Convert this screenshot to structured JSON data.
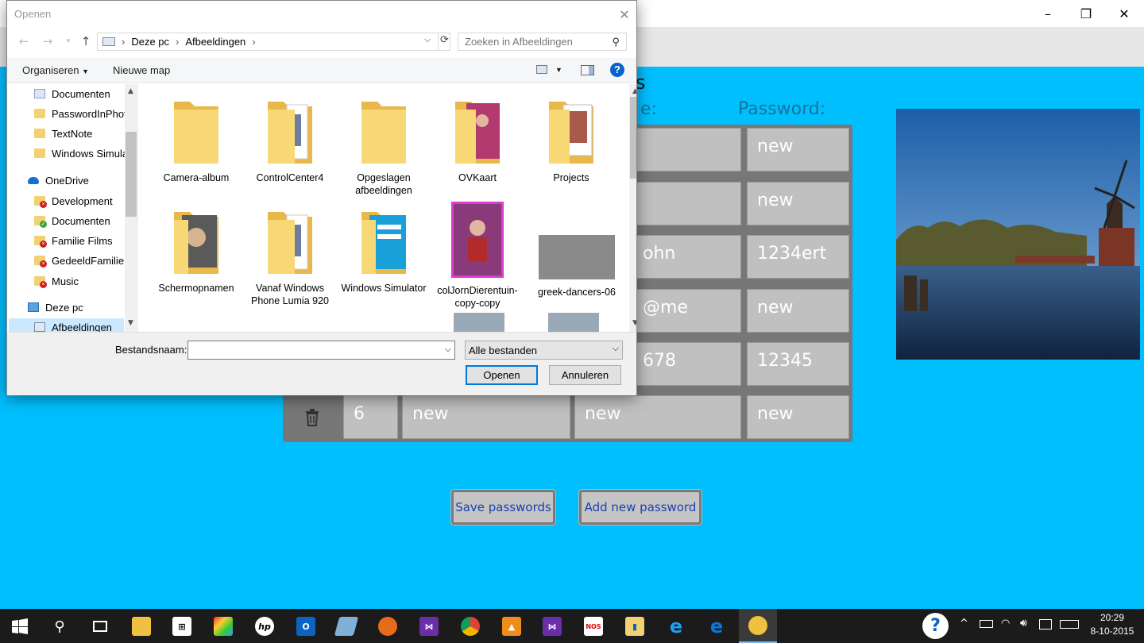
{
  "window": {
    "minimize": "–",
    "maximize": "❐",
    "close": "✕"
  },
  "main": {
    "partial_heading": "s",
    "columns": {
      "username_partial": "e:",
      "password": "Password:"
    },
    "rows": [
      {
        "username": "",
        "password": "new"
      },
      {
        "username": "",
        "password": "new"
      },
      {
        "username": "ohn",
        "password": "1234ert"
      },
      {
        "username": "@me",
        "password": "new"
      },
      {
        "username": "678",
        "password": "12345"
      },
      {
        "id": "6",
        "site": "new",
        "username": "new",
        "password": "new"
      }
    ],
    "save_label": "Save passwords",
    "add_label": "Add new password"
  },
  "dialog": {
    "title": "Openen",
    "address": {
      "root": "Deze pc",
      "folder": "Afbeeldingen"
    },
    "search_placeholder": "Zoeken in Afbeeldingen",
    "toolbar": {
      "organize": "Organiseren",
      "new_folder": "Nieuwe map"
    },
    "nav": [
      {
        "label": "Documenten",
        "type": "folder"
      },
      {
        "label": "PasswordInPhot",
        "type": "folder"
      },
      {
        "label": "TextNote",
        "type": "folder"
      },
      {
        "label": "Windows Simula",
        "type": "folder"
      },
      {
        "label": "OneDrive",
        "type": "cloud"
      },
      {
        "label": "Development",
        "type": "folder-error"
      },
      {
        "label": "Documenten",
        "type": "folder-ok"
      },
      {
        "label": "Familie Films",
        "type": "folder-error"
      },
      {
        "label": "GedeeldFamilie",
        "type": "folder-error"
      },
      {
        "label": "Music",
        "type": "folder-error"
      },
      {
        "label": "Deze pc",
        "type": "pc"
      },
      {
        "label": "Afbeeldingen",
        "type": "pictures"
      }
    ],
    "files": [
      {
        "label": "Camera-album",
        "kind": "folder"
      },
      {
        "label": "ControlCenter4",
        "kind": "folder-docs"
      },
      {
        "label": "Opgeslagen afbeeldingen",
        "kind": "folder"
      },
      {
        "label": "OVKaart",
        "kind": "folder-photo"
      },
      {
        "label": "Projects",
        "kind": "folder-photo"
      },
      {
        "label": "Schermopnamen",
        "kind": "folder-photo"
      },
      {
        "label": "Vanaf Windows Phone Lumia 920",
        "kind": "folder-docs"
      },
      {
        "label": "Windows Simulator",
        "kind": "folder-blue"
      },
      {
        "label": "colJornDierentuin-copy-copy",
        "kind": "image"
      },
      {
        "label": "greek-dancers-06",
        "kind": "image-gray"
      }
    ],
    "filename_label": "Bestandsnaam:",
    "filename_value": "",
    "filter": "Alle bestanden",
    "open_label": "Openen",
    "cancel_label": "Annuleren"
  },
  "taskbar": {
    "icons": [
      "start",
      "search",
      "task-view",
      "file-explorer",
      "store",
      "paint",
      "hp",
      "outlook",
      "notes",
      "firefox",
      "visual-studio",
      "chrome",
      "vlc",
      "visual-studio-2",
      "nos",
      "sticky",
      "internet-explorer",
      "edge",
      "password-app"
    ],
    "time": "20:29",
    "date": "8-10-2015"
  },
  "colors": {
    "background": "#00bfff",
    "accent": "#0078d7",
    "button_text": "#1a3fb0"
  }
}
